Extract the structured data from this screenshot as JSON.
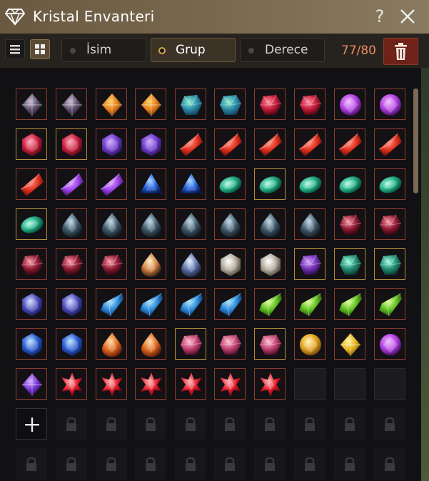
{
  "window": {
    "title": "Kristal Envanteri"
  },
  "toolbar": {
    "filters": [
      {
        "label": "İsim",
        "active": false
      },
      {
        "label": "Grup",
        "active": true
      },
      {
        "label": "Derece",
        "active": false
      }
    ],
    "count": "77/80"
  },
  "colors": {
    "accent": "#d4a55a",
    "count": "#f08a5d",
    "slot_border": "#8a3d30",
    "slot_border_gold": "#b38f3a"
  },
  "grid": {
    "rows": [
      [
        {
          "gem": "black",
          "border": "red"
        },
        {
          "gem": "black",
          "border": "red"
        },
        {
          "gem": "amber",
          "border": "red"
        },
        {
          "gem": "amber",
          "border": "red"
        },
        {
          "gem": "teal-blue",
          "border": "red"
        },
        {
          "gem": "teal-blue",
          "border": "red"
        },
        {
          "gem": "crimson",
          "border": "red"
        },
        {
          "gem": "crimson",
          "border": "red"
        },
        {
          "gem": "purple-round",
          "border": "red"
        },
        {
          "gem": "purple-round",
          "border": "red"
        }
      ],
      [
        {
          "gem": "ruby",
          "border": "gold"
        },
        {
          "gem": "ruby",
          "border": "gold"
        },
        {
          "gem": "amethyst",
          "border": "red"
        },
        {
          "gem": "amethyst",
          "border": "red"
        },
        {
          "gem": "red",
          "border": "red"
        },
        {
          "gem": "red",
          "border": "red"
        },
        {
          "gem": "red",
          "border": "red"
        },
        {
          "gem": "red",
          "border": "red"
        },
        {
          "gem": "red",
          "border": "red"
        },
        {
          "gem": "red",
          "border": "red"
        }
      ],
      [
        {
          "gem": "red",
          "border": "red"
        },
        {
          "gem": "violet",
          "border": "red"
        },
        {
          "gem": "violet",
          "border": "red"
        },
        {
          "gem": "sapphire",
          "border": "red"
        },
        {
          "gem": "sapphire",
          "border": "red"
        },
        {
          "gem": "emerald",
          "border": "red"
        },
        {
          "gem": "emerald",
          "border": "gold"
        },
        {
          "gem": "emerald",
          "border": "red"
        },
        {
          "gem": "emerald",
          "border": "red"
        },
        {
          "gem": "emerald",
          "border": "red"
        }
      ],
      [
        {
          "gem": "emerald",
          "border": "gold"
        },
        {
          "gem": "smoky",
          "border": "red"
        },
        {
          "gem": "smoky",
          "border": "red"
        },
        {
          "gem": "smoky",
          "border": "red"
        },
        {
          "gem": "smoky",
          "border": "red"
        },
        {
          "gem": "smoky",
          "border": "red"
        },
        {
          "gem": "smoky",
          "border": "red"
        },
        {
          "gem": "smoky",
          "border": "red"
        },
        {
          "gem": "garnet",
          "border": "red"
        },
        {
          "gem": "garnet",
          "border": "red"
        }
      ],
      [
        {
          "gem": "garnet",
          "border": "red"
        },
        {
          "gem": "garnet",
          "border": "red"
        },
        {
          "gem": "garnet",
          "border": "red"
        },
        {
          "gem": "fire-drop",
          "border": "red"
        },
        {
          "gem": "ice-drop",
          "border": "red"
        },
        {
          "gem": "silver",
          "border": "red"
        },
        {
          "gem": "silver",
          "border": "red"
        },
        {
          "gem": "purple-dark",
          "border": "gold"
        },
        {
          "gem": "teal-dark",
          "border": "gold"
        },
        {
          "gem": "teal-dark",
          "border": "gold"
        }
      ],
      [
        {
          "gem": "indigo",
          "border": "red"
        },
        {
          "gem": "indigo",
          "border": "red"
        },
        {
          "gem": "blue-shard",
          "border": "red"
        },
        {
          "gem": "blue-shard",
          "border": "red"
        },
        {
          "gem": "blue-shard",
          "border": "red"
        },
        {
          "gem": "blue-shard",
          "border": "red"
        },
        {
          "gem": "lime",
          "border": "red"
        },
        {
          "gem": "lime",
          "border": "red"
        },
        {
          "gem": "lime",
          "border": "red"
        },
        {
          "gem": "lime",
          "border": "red"
        }
      ],
      [
        {
          "gem": "blue-cluster",
          "border": "red"
        },
        {
          "gem": "blue-cluster",
          "border": "red"
        },
        {
          "gem": "orange-drop",
          "border": "red"
        },
        {
          "gem": "orange-drop",
          "border": "red"
        },
        {
          "gem": "rose",
          "border": "gold"
        },
        {
          "gem": "rose",
          "border": "red"
        },
        {
          "gem": "rose",
          "border": "gold"
        },
        {
          "gem": "gold-round",
          "border": "red"
        },
        {
          "gem": "topaz",
          "border": "red"
        },
        {
          "gem": "purple-round",
          "border": "red"
        }
      ],
      [
        {
          "gem": "small-purple",
          "border": "red"
        },
        {
          "gem": "red-star",
          "border": "red"
        },
        {
          "gem": "red-star",
          "border": "red"
        },
        {
          "gem": "red-star",
          "border": "red"
        },
        {
          "gem": "red-star",
          "border": "red"
        },
        {
          "gem": "red-star",
          "border": "red"
        },
        {
          "gem": "red-star",
          "border": "red"
        },
        {
          "gem": "none",
          "border": "empty"
        },
        {
          "gem": "none",
          "border": "empty"
        },
        {
          "gem": "none",
          "border": "empty"
        }
      ]
    ]
  }
}
